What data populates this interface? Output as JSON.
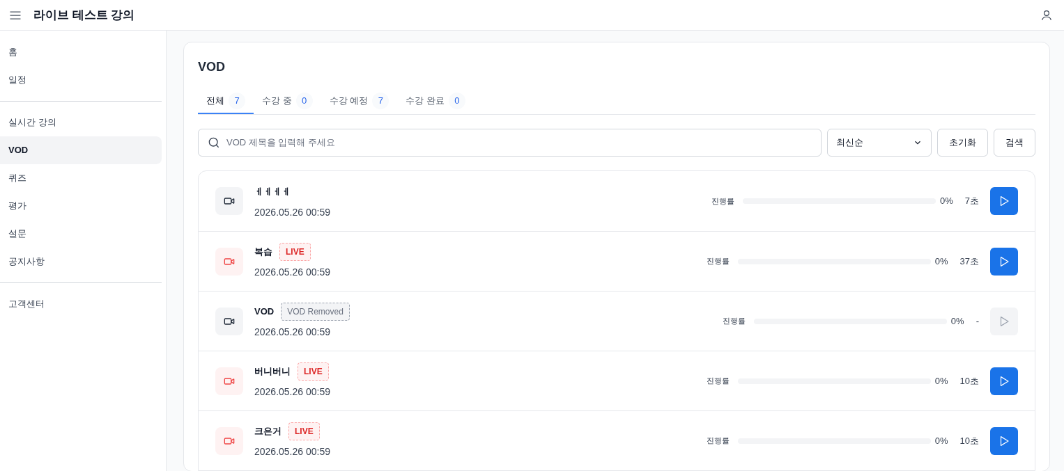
{
  "header": {
    "title": "라이브 테스트 강의"
  },
  "sidebar": {
    "groups": [
      [
        {
          "label": "홈",
          "selected": false
        },
        {
          "label": "일정",
          "selected": false
        }
      ],
      [
        {
          "label": "실시간 강의",
          "selected": false
        },
        {
          "label": "VOD",
          "selected": true
        },
        {
          "label": "퀴즈",
          "selected": false
        },
        {
          "label": "평가",
          "selected": false
        },
        {
          "label": "설문",
          "selected": false
        },
        {
          "label": "공지사항",
          "selected": false
        }
      ],
      [
        {
          "label": "고객센터",
          "selected": false
        }
      ]
    ]
  },
  "page": {
    "title": "VOD",
    "tabs": [
      {
        "label": "전체",
        "count": "7",
        "selected": true
      },
      {
        "label": "수강 중",
        "count": "0",
        "selected": false
      },
      {
        "label": "수강 예정",
        "count": "7",
        "selected": false
      },
      {
        "label": "수강 완료",
        "count": "0",
        "selected": false
      }
    ],
    "search": {
      "placeholder": "VOD 제목을 입력해 주세요"
    },
    "sort": {
      "value": "최신순"
    },
    "buttons": [
      "초기화",
      "검색"
    ],
    "rows": [
      {
        "kind": "vod",
        "title": "ㅔㅔㅔㅔ",
        "date": "2026.05.26 00:59",
        "progress_label": "진행률",
        "level": 0,
        "percent": "0%",
        "duration": "7초",
        "disabled": false
      },
      {
        "kind": "live",
        "title": "복습",
        "badge": "LIVE",
        "date": "2026.05.26 00:59",
        "progress_label": "진행률",
        "level": 0,
        "percent": "0%",
        "duration": "37초",
        "disabled": false
      },
      {
        "kind": "removed",
        "title": "VOD",
        "badge": "VOD Removed",
        "date": "2026.05.26 00:59",
        "progress_label": "진행률",
        "level": 0,
        "percent": "0%",
        "duration": "-",
        "disabled": true
      },
      {
        "kind": "live",
        "title": "버니버니",
        "badge": "LIVE",
        "date": "2026.05.26 00:59",
        "progress_label": "진행률",
        "level": 0,
        "percent": "0%",
        "duration": "10초",
        "disabled": false
      },
      {
        "kind": "live",
        "title": "크은거",
        "badge": "LIVE",
        "date": "2026.05.26 00:59",
        "progress_label": "진행률",
        "level": 0,
        "percent": "0%",
        "duration": "10초",
        "disabled": false
      }
    ]
  }
}
